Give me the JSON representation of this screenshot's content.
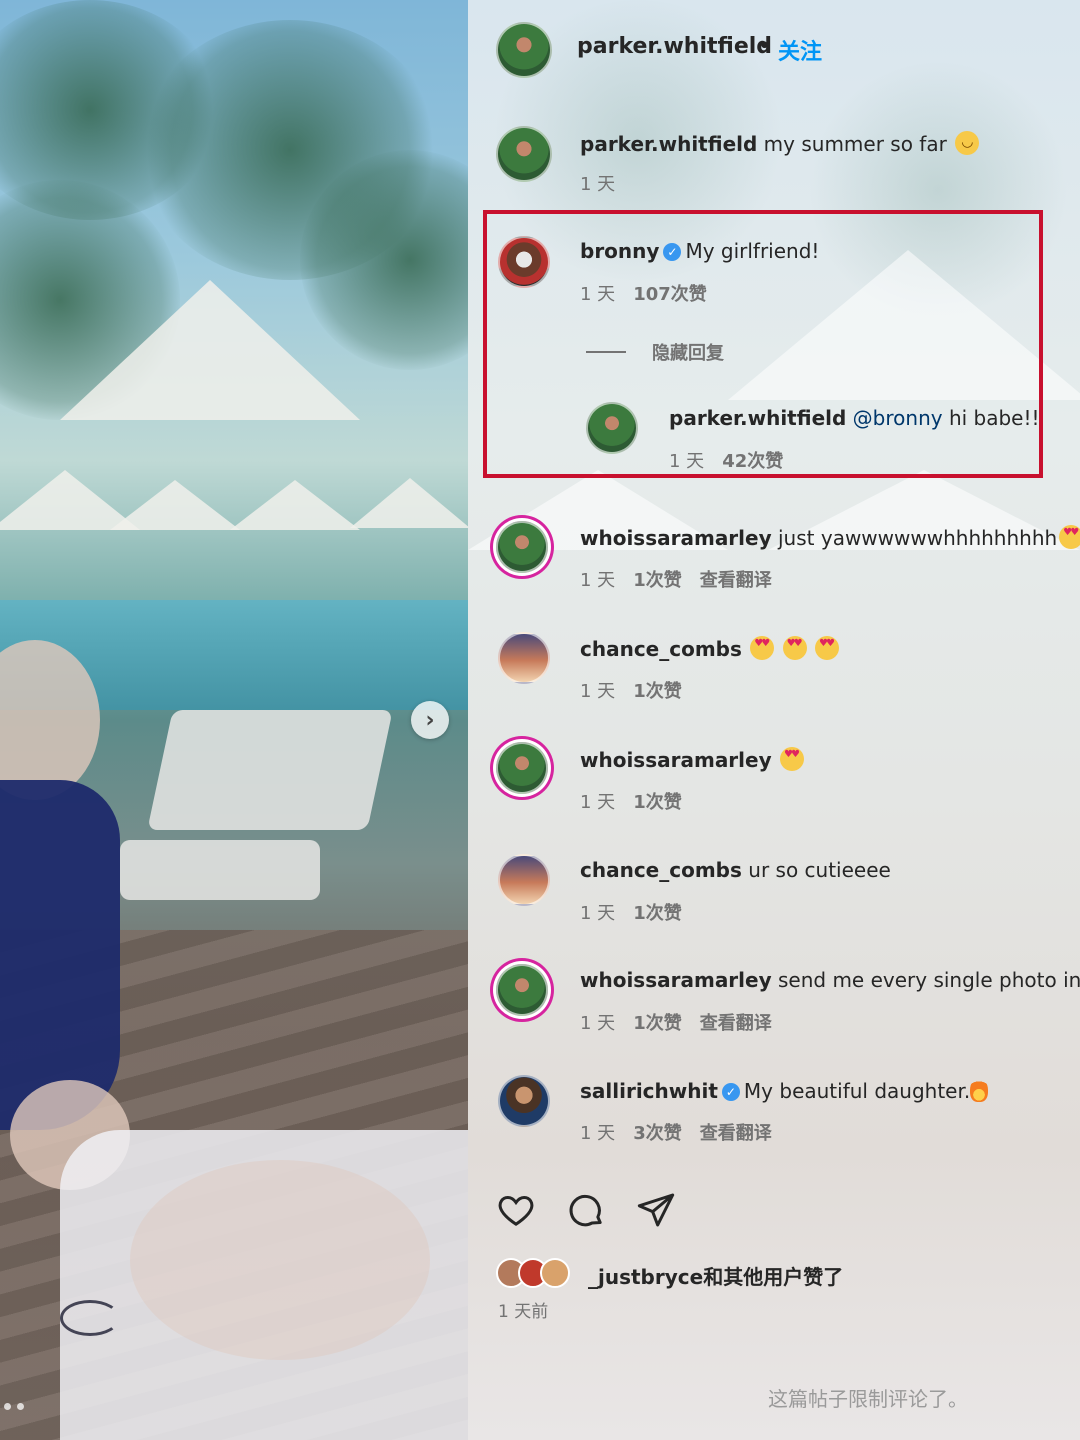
{
  "header": {
    "username": "parker.whitfield",
    "separator": "•",
    "follow_label": "关注"
  },
  "caption": {
    "username": "parker.whitfield",
    "text": "my summer so far",
    "emoji": "hugging-face-emoji",
    "time": "1 天"
  },
  "comments": [
    {
      "username": "bronny",
      "verified": true,
      "text": "My girlfriend!",
      "time": "1 天",
      "likes": "107次赞",
      "replies_toggle": "隐藏回复"
    },
    {
      "username": "parker.whitfield",
      "mention": "@bronny",
      "text": "hi babe!!",
      "time": "1 天",
      "likes": "42次赞"
    },
    {
      "username": "whoissaramarley",
      "text": "just yawwwwwwhhhhhhhhh",
      "emoji": "heart-eyes-emoji",
      "time": "1 天",
      "likes": "1次赞",
      "translate": "查看翻译"
    },
    {
      "username": "chance_combs",
      "text": "",
      "emoji": "heart-eyes-emoji x3",
      "time": "1 天",
      "likes": "1次赞"
    },
    {
      "username": "whoissaramarley",
      "text": "",
      "emoji": "heart-eyes-emoji",
      "time": "1 天",
      "likes": "1次赞"
    },
    {
      "username": "chance_combs",
      "text": "ur so cutieeee",
      "time": "1 天",
      "likes": "1次赞"
    },
    {
      "username": "whoissaramarley",
      "text": "send me every single photo in y",
      "time": "1 天",
      "likes": "1次赞",
      "translate": "查看翻译"
    },
    {
      "username": "sallirichwhit",
      "verified": true,
      "text": "My beautiful daughter.",
      "emoji": "fire-emoji",
      "time": "1 天",
      "likes": "3次赞",
      "translate": "查看翻译"
    }
  ],
  "actions": {
    "like_icon": "heart-icon",
    "comment_icon": "comment-icon",
    "share_icon": "paper-plane-icon"
  },
  "likes_summary": "_justbryce和其他用户赞了",
  "post_time": "1 天前",
  "comments_limited": "这篇帖子限制评论了。",
  "highlight_color": "#c8102e",
  "accent_color": "#0095f6"
}
